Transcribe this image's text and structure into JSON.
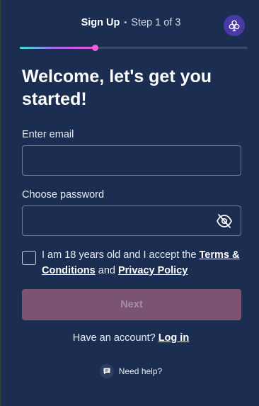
{
  "header": {
    "title": "Sign Up",
    "separator": "•",
    "step": "Step 1 of 3",
    "progress_fraction": 0.33
  },
  "logo": {
    "icon": "club-logo-icon",
    "accent": "#4a3aa8"
  },
  "form": {
    "heading": "Welcome, let's get you started!",
    "email_label": "Enter email",
    "email_value": "",
    "password_label": "Choose password",
    "password_value": "",
    "password_toggle_icon": "eye-off-icon",
    "terms_prefix": "I am 18 years old and I accept the",
    "terms_link": "Terms & Conditions",
    "terms_and": "and",
    "privacy_link": "Privacy Policy",
    "terms_checked": false,
    "next_label": "Next"
  },
  "footer": {
    "have_account": "Have an account?",
    "login_link": "Log in",
    "help_label": "Need help?",
    "help_icon": "chat-icon"
  },
  "colors": {
    "background": "#1b2e52",
    "button_disabled": "#7a5470",
    "progress_start": "#34e3d8",
    "progress_end": "#f04fd9"
  }
}
